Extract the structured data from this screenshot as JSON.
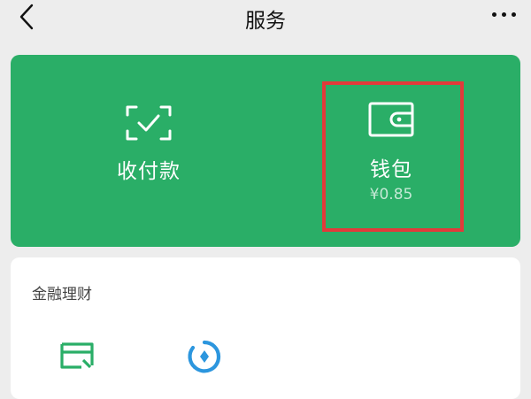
{
  "header": {
    "title": "服务",
    "back_icon": "chevron-left-icon",
    "more_icon": "more-dots-icon"
  },
  "green_card": {
    "pay": {
      "label": "收付款",
      "icon": "scan-check-icon"
    },
    "wallet": {
      "label": "钱包",
      "balance": "¥0.85",
      "icon": "wallet-icon"
    },
    "colors": {
      "background": "#2aae67",
      "highlight": "#e23a3a"
    }
  },
  "finance": {
    "title": "金融理财",
    "icons": [
      "credit-card-icon",
      "fund-icon"
    ]
  }
}
